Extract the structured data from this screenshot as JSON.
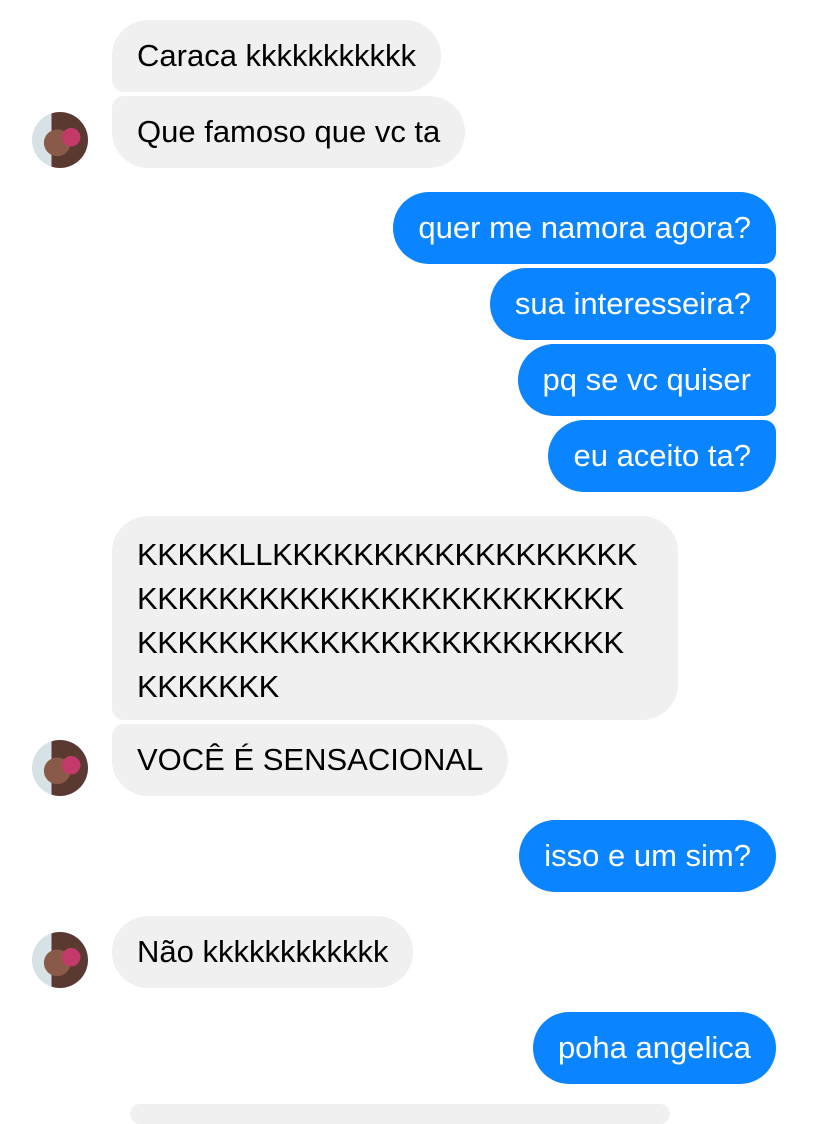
{
  "conversation": {
    "colors": {
      "incoming_bubble": "#f1f0f0",
      "outgoing_bubble": "#0a84ff"
    },
    "messages": [
      {
        "sender": "contact",
        "text": "Caraca kkkkkkkkkkk"
      },
      {
        "sender": "contact",
        "text": "Que famoso que vc ta",
        "avatar": "contact-avatar"
      },
      {
        "sender": "me",
        "text": "quer me namora agora?"
      },
      {
        "sender": "me",
        "text": "sua interesseira?"
      },
      {
        "sender": "me",
        "text": "pq se vc quiser"
      },
      {
        "sender": "me",
        "text": "eu aceito ta?"
      },
      {
        "sender": "contact",
        "text": "KKKKKLLKKKKKKKKKKKKKKKKKK KKKKKKKKKKKKKKKKKKKKKKKK KKKKKKKKKKKKKKKKKKKKKKKK KKKKKKK"
      },
      {
        "sender": "contact",
        "text": "VOCÊ É SENSACIONAL",
        "avatar": "contact-avatar"
      },
      {
        "sender": "me",
        "text": "isso e um sim?"
      },
      {
        "sender": "contact",
        "text": "Não kkkkkkkkkkkk",
        "avatar": "contact-avatar"
      },
      {
        "sender": "me",
        "text": "poha angelica"
      }
    ]
  }
}
